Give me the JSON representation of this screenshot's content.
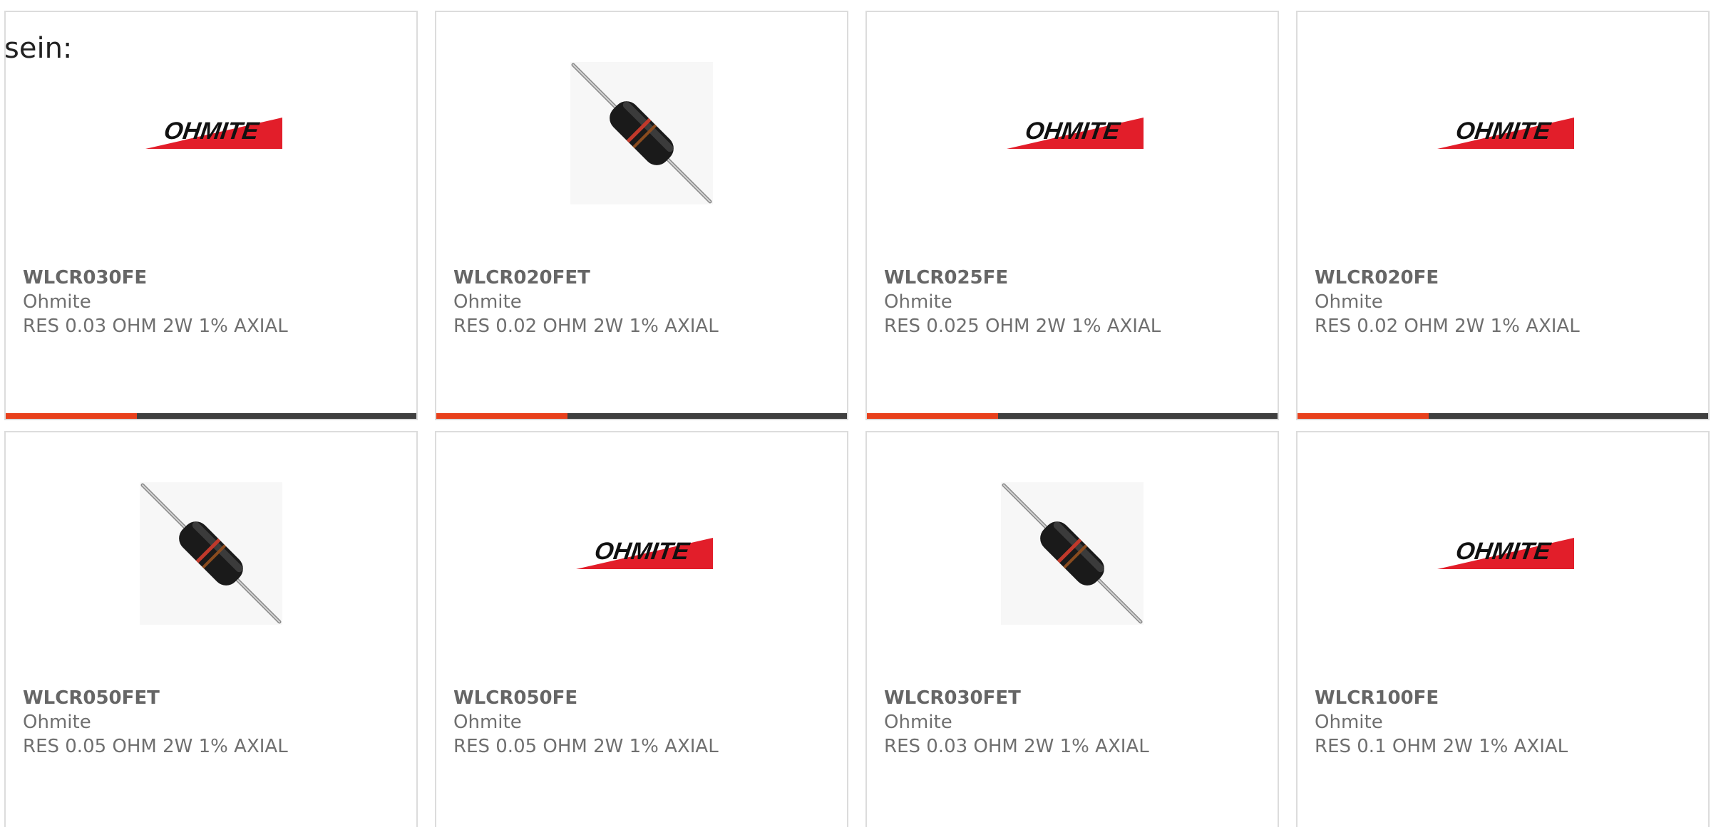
{
  "intro_text": "sein:",
  "colors": {
    "accent": "#e8401c",
    "bar_track": "#3f3f3f",
    "logo_red": "#e21e2a",
    "text_gray": "#6f6f6f"
  },
  "products": [
    {
      "part_number": "WLCR030FE",
      "manufacturer": "Ohmite",
      "description": "RES 0.03 OHM 2W 1% AXIAL",
      "image": "ohmite-logo-icon",
      "bar_fill_fraction": 0.32
    },
    {
      "part_number": "WLCR020FET",
      "manufacturer": "Ohmite",
      "description": "RES 0.02 OHM 2W 1% AXIAL",
      "image": "axial-resistor-icon",
      "bar_fill_fraction": 0.32
    },
    {
      "part_number": "WLCR025FE",
      "manufacturer": "Ohmite",
      "description": "RES 0.025 OHM 2W 1% AXIAL",
      "image": "ohmite-logo-icon",
      "bar_fill_fraction": 0.32
    },
    {
      "part_number": "WLCR020FE",
      "manufacturer": "Ohmite",
      "description": "RES 0.02 OHM 2W 1% AXIAL",
      "image": "ohmite-logo-icon",
      "bar_fill_fraction": 0.32
    },
    {
      "part_number": "WLCR050FET",
      "manufacturer": "Ohmite",
      "description": "RES 0.05 OHM 2W 1% AXIAL",
      "image": "axial-resistor-icon",
      "bar_fill_fraction": 0.32
    },
    {
      "part_number": "WLCR050FE",
      "manufacturer": "Ohmite",
      "description": "RES 0.05 OHM 2W 1% AXIAL",
      "image": "ohmite-logo-icon",
      "bar_fill_fraction": 0.32
    },
    {
      "part_number": "WLCR030FET",
      "manufacturer": "Ohmite",
      "description": "RES 0.03 OHM 2W 1% AXIAL",
      "image": "axial-resistor-icon",
      "bar_fill_fraction": 0.32
    },
    {
      "part_number": "WLCR100FE",
      "manufacturer": "Ohmite",
      "description": "RES 0.1 OHM 2W 1% AXIAL",
      "image": "ohmite-logo-icon",
      "bar_fill_fraction": 0.32
    }
  ],
  "logo_text": "OHMITE"
}
